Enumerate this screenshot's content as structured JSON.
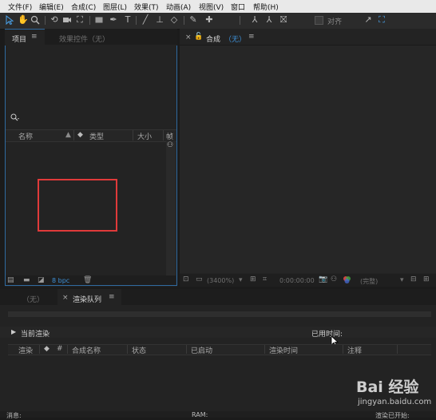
{
  "menu": [
    "文件(F)",
    "编辑(E)",
    "合成(C)",
    "图层(L)",
    "效果(T)",
    "动画(A)",
    "视图(V)",
    "窗口",
    "帮助(H)"
  ],
  "toolbar": {
    "align_label": "对齐"
  },
  "project_panel": {
    "tab_project": "项目",
    "tab_project_menu": "≡",
    "tab_effects": "效果控件（无）",
    "columns": [
      "名称",
      "类型",
      "大小",
      "帧"
    ],
    "bpc": "8 bpc"
  },
  "composition_panel": {
    "close": "×",
    "tab_label": "合成",
    "tab_value": "（无）",
    "tab_menu": "≡",
    "zoom": "(3400%)",
    "timecode": "0:00:00:00",
    "quality": "(完整)"
  },
  "bottom_panel": {
    "tab_none": "（无）",
    "close": "×",
    "tab_render_queue": "渲染队列",
    "tab_menu": "≡",
    "current_render": "当前渲染",
    "elapsed": "已用时间:",
    "columns": [
      "渲染",
      "#",
      "合成名称",
      "状态",
      "已启动",
      "渲染时间",
      "注释"
    ],
    "footer_left": "消息:",
    "footer_mid": "RAM:",
    "footer_right": "渲染已开始:"
  },
  "watermark": {
    "brand": "Bai 经验",
    "url": "jingyan.baidu.com"
  },
  "colors": {
    "accent": "#4aa1e8",
    "highlight_box": "#e03a3a",
    "panel": "#232323",
    "background": "#1b1b1b"
  }
}
